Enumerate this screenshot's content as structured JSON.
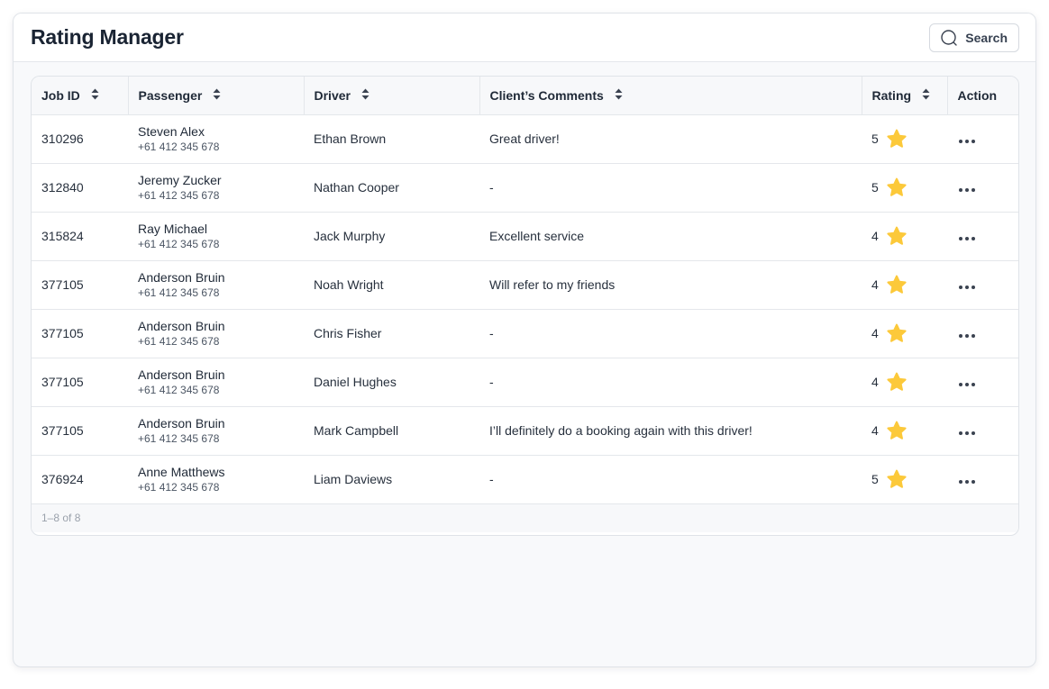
{
  "header": {
    "title": "Rating Manager",
    "search_label": "Search"
  },
  "table": {
    "columns": [
      "Job ID",
      "Passenger",
      "Driver",
      "Client’s Comments",
      "Rating",
      "Action"
    ],
    "rows": [
      {
        "job_id": "310296",
        "passenger": "Steven Alex",
        "phone": "+61 412 345 678",
        "driver": "Ethan Brown",
        "comment": "Great driver!",
        "rating": "5"
      },
      {
        "job_id": "312840",
        "passenger": "Jeremy Zucker",
        "phone": "+61 412 345 678",
        "driver": "Nathan Cooper",
        "comment": "-",
        "rating": "5"
      },
      {
        "job_id": "315824",
        "passenger": "Ray Michael",
        "phone": "+61 412 345 678",
        "driver": "Jack Murphy",
        "comment": "Excellent service",
        "rating": "4"
      },
      {
        "job_id": "377105",
        "passenger": "Anderson Bruin",
        "phone": "+61 412 345 678",
        "driver": "Noah Wright",
        "comment": "Will refer to my friends",
        "rating": "4"
      },
      {
        "job_id": "377105",
        "passenger": "Anderson Bruin",
        "phone": "+61 412 345 678",
        "driver": "Chris Fisher",
        "comment": "-",
        "rating": "4"
      },
      {
        "job_id": "377105",
        "passenger": "Anderson Bruin",
        "phone": "+61 412 345 678",
        "driver": "Daniel Hughes",
        "comment": "-",
        "rating": "4"
      },
      {
        "job_id": "377105",
        "passenger": "Anderson Bruin",
        "phone": "+61 412 345 678",
        "driver": "Mark Campbell",
        "comment": "I’ll definitely do a booking again with this driver!",
        "rating": "4"
      },
      {
        "job_id": "376924",
        "passenger": "Anne Matthews",
        "phone": "+61 412 345 678",
        "driver": "Liam Daviews",
        "comment": "-",
        "rating": "5"
      }
    ],
    "pagination": "1–8 of 8"
  },
  "icons": {
    "search": "search-icon",
    "sort": "sort-icon",
    "star": "star-icon",
    "more": "more-icon"
  },
  "colors": {
    "star": "#fcc93a",
    "title": "#1a2433",
    "border": "#e4e7eb",
    "background": "#f8f9fb"
  }
}
